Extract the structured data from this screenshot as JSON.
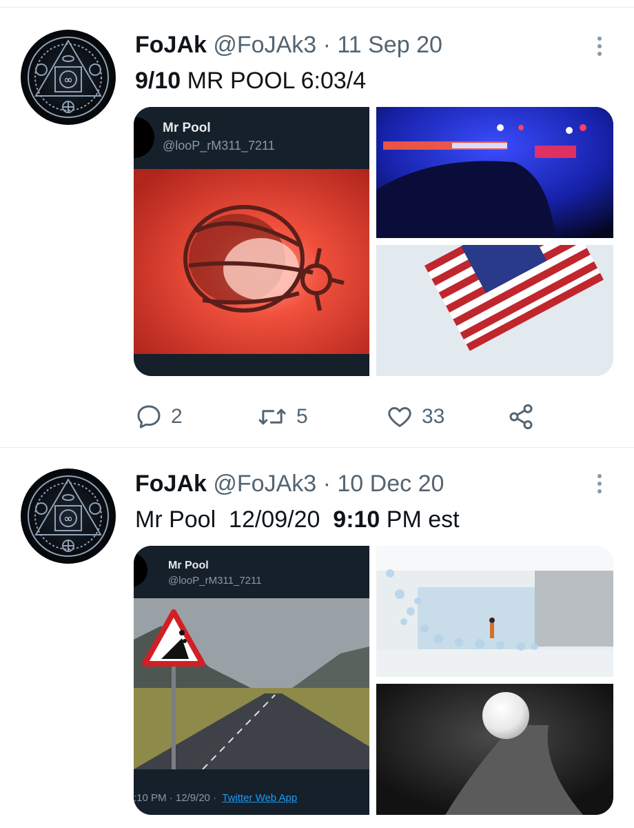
{
  "tweets": [
    {
      "name": "FoJAk",
      "handle": "@FoJAk3",
      "separator": "·",
      "date": "11 Sep 20",
      "text_bold": "9/10",
      "text_rest": " MR POOL 6:03/4",
      "embed": {
        "name": "Mr Pool",
        "handle": "@looP_rM311_7211"
      },
      "stats": {
        "replies": "2",
        "retweets": "5",
        "likes": "33"
      }
    },
    {
      "name": "FoJAk",
      "handle": "@FoJAk3",
      "separator": "·",
      "date": "10 Dec 20",
      "text_pre": "Mr Pool  12/09/20  ",
      "text_bold": "9:10",
      "text_post": " PM est",
      "embed": {
        "name": "Mr Pool",
        "handle": "@looP_rM311_7211",
        "footer_time": ":10 PM · 12/9/20 · ",
        "footer_app": "Twitter Web App"
      }
    }
  ],
  "icons": {
    "more": "more-vertical-icon",
    "reply": "reply-icon",
    "retweet": "retweet-icon",
    "like": "heart-icon",
    "share": "share-icon"
  },
  "colors": {
    "text": "#0f1419",
    "secondary": "#536471",
    "embed_bg": "#15202b",
    "link": "#1d9bf0"
  }
}
